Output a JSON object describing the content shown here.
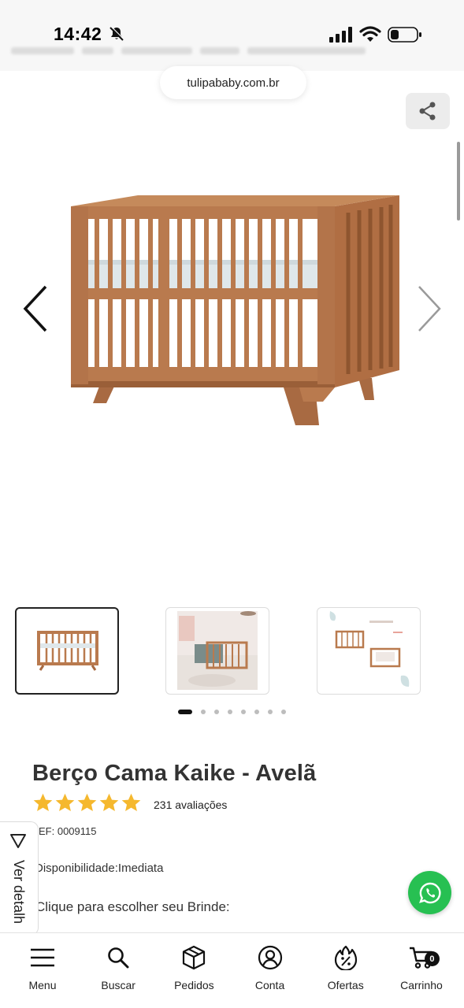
{
  "status_bar": {
    "time": "14:42",
    "icons": [
      "bell-slash-icon",
      "signal-icon",
      "wifi-icon",
      "battery-icon"
    ]
  },
  "browser": {
    "url": "tulipababy.com.br"
  },
  "gallery": {
    "icons": [
      "share-icon",
      "chevron-left-icon",
      "chevron-right-icon"
    ],
    "thumbnails": [
      "crib-front-view",
      "crib-in-nursery-room",
      "crib-conversion-infographic"
    ],
    "active_thumbnail": 1,
    "slide_count": 8,
    "active_slide": 1
  },
  "product": {
    "title": "Berço Cama Kaike - Avelã",
    "rating": 5,
    "reviews": "231 avaliações",
    "ref": "EF: 0009115",
    "availability": "Disponibilidade:Imediata",
    "gift_prompt": "Clique para escolher seu Brinde:"
  },
  "details_tab": {
    "label": "Ver detalh"
  },
  "whatsapp": {
    "icon": "whatsapp-icon",
    "color": "#27c052"
  },
  "bottom_nav": {
    "items": [
      {
        "label": "Menu",
        "icon": "hamburger-icon"
      },
      {
        "label": "Buscar",
        "icon": "search-icon"
      },
      {
        "label": "Pedidos",
        "icon": "box-icon"
      },
      {
        "label": "Conta",
        "icon": "user-circle-icon"
      },
      {
        "label": "Ofertas",
        "icon": "discount-flame-icon"
      },
      {
        "label": "Carrinho",
        "icon": "cart-icon"
      }
    ],
    "cart_count": "0"
  },
  "colors": {
    "wood": "#b97a4e",
    "wood_dark": "#9a5f38",
    "star": "#f5b82e",
    "mattress": "#dfe7ea"
  }
}
